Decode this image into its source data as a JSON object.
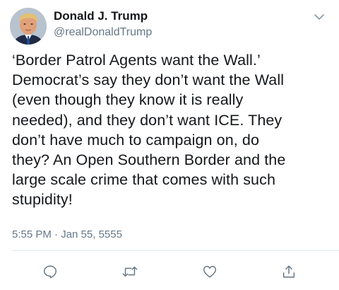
{
  "author": {
    "display_name": "Donald J. Trump",
    "handle": "@realDonaldTrump",
    "avatar_icon": "profile-photo"
  },
  "tweet": {
    "text": "‘Border Patrol Agents want the Wall.’\nDemocrat’s say they don’t want the Wall\n(even though they know it is really\nneeded), and they don’t want ICE. They\ndon’t have much to campaign on, do\nthey? An Open Southern Border and the\nlarge scale crime that comes with such\nstupidity!",
    "timestamp": "5:55 PM · Jan 55, 5555"
  },
  "actions": {
    "reply_icon": "comment-bubble-icon",
    "retweet_icon": "retweet-arrows-icon",
    "like_icon": "heart-icon",
    "share_icon": "share-upload-icon",
    "more_icon": "chevron-down-icon"
  },
  "colors": {
    "text_primary": "#14171a",
    "text_secondary": "#657786",
    "icon": "#657786",
    "divider": "#e1e8ed"
  }
}
